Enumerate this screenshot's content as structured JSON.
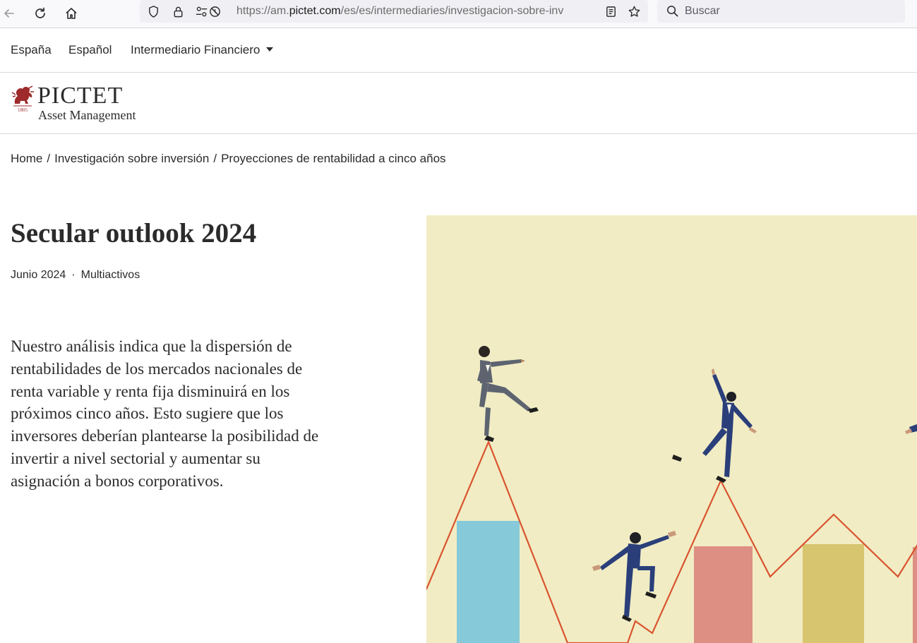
{
  "browser": {
    "url_prefix": "https://am.",
    "url_host": "pictet.com",
    "url_path": "/es/es/intermediaries/investigacion-sobre-inv",
    "search_placeholder": "Buscar"
  },
  "topnav": {
    "country": "España",
    "language": "Español",
    "audience": "Intermediario Financiero"
  },
  "logo": {
    "name": "PICTET",
    "sub": "Asset Management",
    "year": "1805"
  },
  "breadcrumb": {
    "home": "Home",
    "section": "Investigación sobre inversión",
    "current": "Proyecciones de rentabilidad a cinco años",
    "separator": "/"
  },
  "article": {
    "title": "Secular outlook 2024",
    "date": "Junio 2024",
    "meta_separator": "·",
    "category": "Multiactivos",
    "intro": "Nuestro análisis indica que la dispersión de rentabilidades de los mercados nacionales de renta variable y renta fija disminuirá en los próximos cinco años. Esto sugiere que los inversores deberían plantearse la posibilidad de invertir a nivel sectorial y aumentar su asignación a bonos corporativos."
  },
  "colors": {
    "hero_background": "#f1ecc4",
    "line": "#d9542e",
    "bar_blue": "#86c9d8",
    "bar_red": "#de8f83",
    "bar_yellow": "#d7c56f",
    "suit_navy": "#2a3f7a",
    "suit_grey": "#5d6470",
    "logo_red": "#9e2a2b"
  },
  "icons": [
    "back-arrow-icon",
    "reload-icon",
    "home-icon",
    "shield-icon",
    "lock-icon",
    "permissions-icon",
    "reader-view-icon",
    "bookmark-star-icon",
    "search-icon",
    "chevron-down-icon",
    "lion-logo-icon"
  ]
}
